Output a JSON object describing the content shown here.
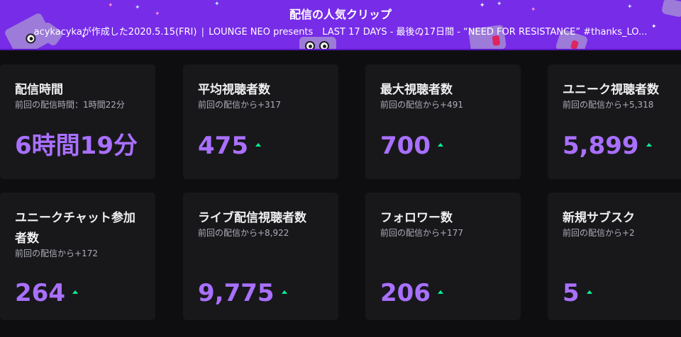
{
  "header": {
    "title": "配信の人気クリップ",
    "subtitle_parts": [
      "acykacykaが作成した2020.5.15(FRI)",
      "LOUNGE NEO presents　LAST 17 DAYS - 最後の17日間 - “NEED FOR RESISTANCE” #thanks_LO..."
    ],
    "separator": "|"
  },
  "colors": {
    "banner_bg": "#772ce8",
    "card_bg": "#18181b",
    "value_purple": "#a970ff",
    "trend_up_green": "#00f593",
    "page_bg": "#0e0e10"
  },
  "stats": [
    {
      "title": "配信時間",
      "sub": "前回の配信時間：1時間22分",
      "value": "6時間19分",
      "trend": ""
    },
    {
      "title": "平均視聴者数",
      "sub": "前回の配信から+317",
      "value": "475",
      "trend": "up"
    },
    {
      "title": "最大視聴者数",
      "sub": "前回の配信から+491",
      "value": "700",
      "trend": "up"
    },
    {
      "title": "ユニーク視聴者数",
      "sub": "前回の配信から+5,318",
      "value": "5,899",
      "trend": "up"
    },
    {
      "title": "ユニークチャット参加者数",
      "sub": "前回の配信から+172",
      "value": "264",
      "trend": "up"
    },
    {
      "title": "ライブ配信視聴者数",
      "sub": "前回の配信から+8,922",
      "value": "9,775",
      "trend": "up"
    },
    {
      "title": "フォロワー数",
      "sub": "前回の配信から+177",
      "value": "206",
      "trend": "up"
    },
    {
      "title": "新規サブスク",
      "sub": "前回の配信から+2",
      "value": "5",
      "trend": "up"
    }
  ],
  "icons": {
    "trend": "trend-up-icon",
    "mascot": "glitch-mascot-icon"
  }
}
